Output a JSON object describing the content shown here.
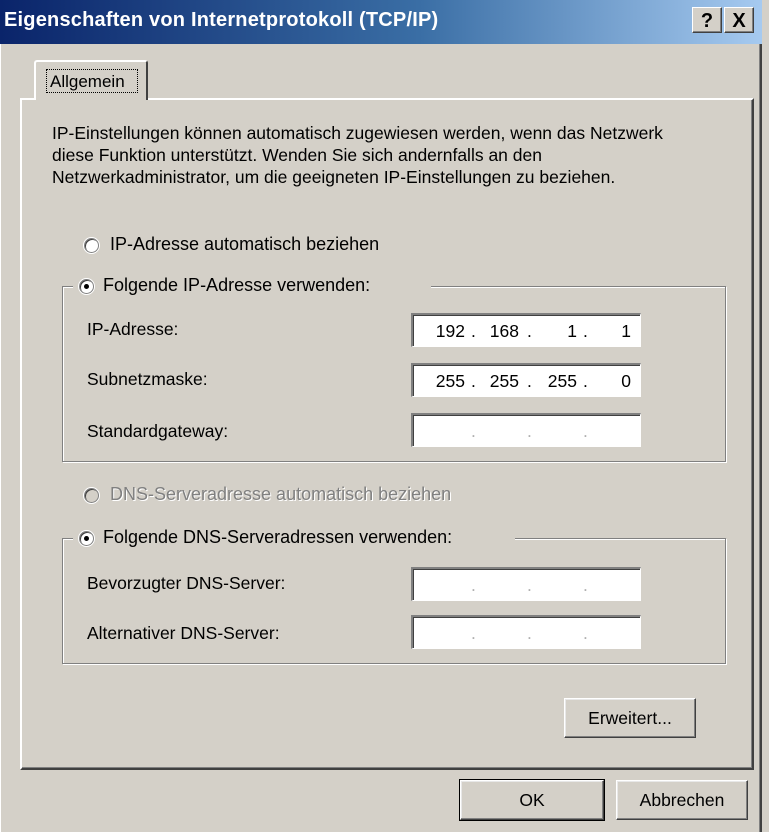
{
  "window": {
    "title": "Eigenschaften von Internetprotokoll (TCP/IP)",
    "help_glyph": "?",
    "close_glyph": "X"
  },
  "tabs": [
    {
      "label": "Allgemein",
      "selected": true
    }
  ],
  "description": "IP-Einstellungen können automatisch zugewiesen werden, wenn das Netzwerk diese Funktion unterstützt. Wenden Sie sich andernfalls an den Netzwerkadministrator, um die geeigneten IP-Einstellungen zu beziehen.",
  "ip_section": {
    "auto_label": "IP-Adresse automatisch beziehen",
    "auto_selected": false,
    "manual_label": "Folgende IP-Adresse verwenden:",
    "manual_selected": true,
    "fields": [
      {
        "label": "IP-Adresse:",
        "octets": [
          "192",
          "168",
          "1",
          "1"
        ]
      },
      {
        "label": "Subnetzmaske:",
        "octets": [
          "255",
          "255",
          "255",
          "0"
        ]
      },
      {
        "label": "Standardgateway:",
        "octets": [
          "",
          "",
          "",
          ""
        ]
      }
    ]
  },
  "dns_section": {
    "auto_label": "DNS-Serveradresse automatisch beziehen",
    "auto_selected": false,
    "auto_disabled": true,
    "manual_label": "Folgende DNS-Serveradressen verwenden:",
    "manual_selected": true,
    "fields": [
      {
        "label": "Bevorzugter DNS-Server:",
        "octets": [
          "",
          "",
          "",
          ""
        ]
      },
      {
        "label": "Alternativer DNS-Server:",
        "octets": [
          "",
          "",
          "",
          ""
        ]
      }
    ]
  },
  "buttons": {
    "advanced": "Erweitert...",
    "ok": "OK",
    "cancel": "Abbrechen"
  },
  "ip_dot": "."
}
